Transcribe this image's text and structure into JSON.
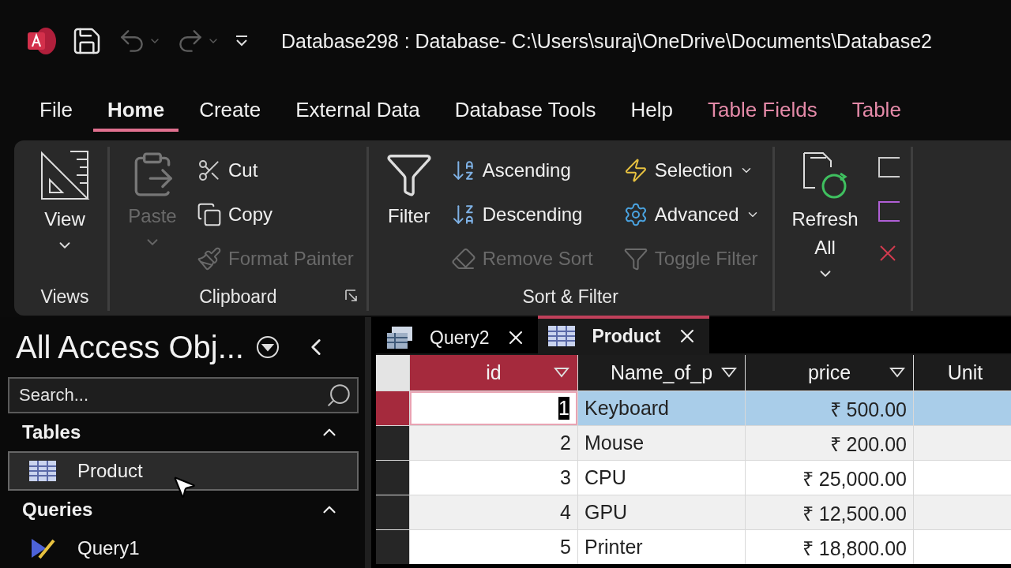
{
  "window": {
    "title": "Database298 : Database- C:\\Users\\suraj\\OneDrive\\Documents\\Database2"
  },
  "ribbon_tabs": [
    {
      "label": "File",
      "selected": false,
      "kind": "standard"
    },
    {
      "label": "Home",
      "selected": true,
      "kind": "standard"
    },
    {
      "label": "Create",
      "selected": false,
      "kind": "standard"
    },
    {
      "label": "External Data",
      "selected": false,
      "kind": "standard"
    },
    {
      "label": "Database Tools",
      "selected": false,
      "kind": "standard"
    },
    {
      "label": "Help",
      "selected": false,
      "kind": "standard"
    },
    {
      "label": "Table Fields",
      "selected": false,
      "kind": "contextual"
    },
    {
      "label": "Table",
      "selected": false,
      "kind": "contextual"
    }
  ],
  "ribbon_groups": [
    {
      "label": "Views",
      "launcher": false,
      "items": [
        {
          "kind": "large",
          "label": "View",
          "disabled": false,
          "dropdown": true
        }
      ]
    },
    {
      "label": "Clipboard",
      "launcher": true,
      "items": [
        {
          "kind": "large",
          "label": "Paste",
          "disabled": true,
          "dropdown": true
        },
        {
          "kind": "small",
          "label": "Cut",
          "disabled": false,
          "dropdown": false
        },
        {
          "kind": "small",
          "label": "Copy",
          "disabled": false,
          "dropdown": false
        },
        {
          "kind": "small",
          "label": "Format Painter",
          "disabled": true,
          "dropdown": false
        }
      ]
    },
    {
      "label": "Sort & Filter",
      "launcher": false,
      "items": [
        {
          "kind": "large",
          "label": "Filter",
          "disabled": false,
          "dropdown": false
        },
        {
          "kind": "small",
          "label": "Ascending",
          "disabled": false,
          "dropdown": false
        },
        {
          "kind": "small",
          "label": "Descending",
          "disabled": false,
          "dropdown": false
        },
        {
          "kind": "small",
          "label": "Remove Sort",
          "disabled": true,
          "dropdown": false
        },
        {
          "kind": "small",
          "label": "Selection",
          "disabled": false,
          "dropdown": true
        },
        {
          "kind": "small",
          "label": "Advanced",
          "disabled": false,
          "dropdown": true
        },
        {
          "kind": "small",
          "label": "Toggle Filter",
          "disabled": true,
          "dropdown": false
        }
      ]
    },
    {
      "items": [
        {
          "kind": "large",
          "label": "Refresh All",
          "disabled": false,
          "dropdown": true
        }
      ]
    }
  ],
  "navigation": {
    "title": "All Access Obj...",
    "search": {
      "placeholder": "Search..."
    },
    "sections": [
      {
        "label": "Tables",
        "expanded": true,
        "items": [
          {
            "label": "Product",
            "selected": true
          }
        ]
      },
      {
        "label": "Queries",
        "expanded": true,
        "items": [
          {
            "label": "Query1",
            "selected": false
          }
        ]
      }
    ]
  },
  "document_tabs": [
    {
      "label": "Query2",
      "selected": false
    },
    {
      "label": "Product",
      "selected": true
    }
  ],
  "table": {
    "columns": [
      {
        "label": "id",
        "selected": true,
        "dropdown": true
      },
      {
        "label": "Name_of_p",
        "selected": false,
        "dropdown": true
      },
      {
        "label": "price",
        "selected": false,
        "dropdown": true
      },
      {
        "label": "Unit",
        "selected": false,
        "dropdown": false
      }
    ],
    "rows": [
      {
        "selected": true,
        "cells": [
          "1",
          "Keyboard",
          "₹ 500.00"
        ]
      },
      {
        "selected": false,
        "cells": [
          "2",
          "Mouse",
          "₹ 200.00"
        ]
      },
      {
        "selected": false,
        "cells": [
          "3",
          "CPU",
          "₹ 25,000.00"
        ]
      },
      {
        "selected": false,
        "cells": [
          "4",
          "GPU",
          "₹ 12,500.00"
        ]
      },
      {
        "selected": false,
        "cells": [
          "5",
          "Printer",
          "₹ 18,800.00"
        ]
      }
    ]
  }
}
